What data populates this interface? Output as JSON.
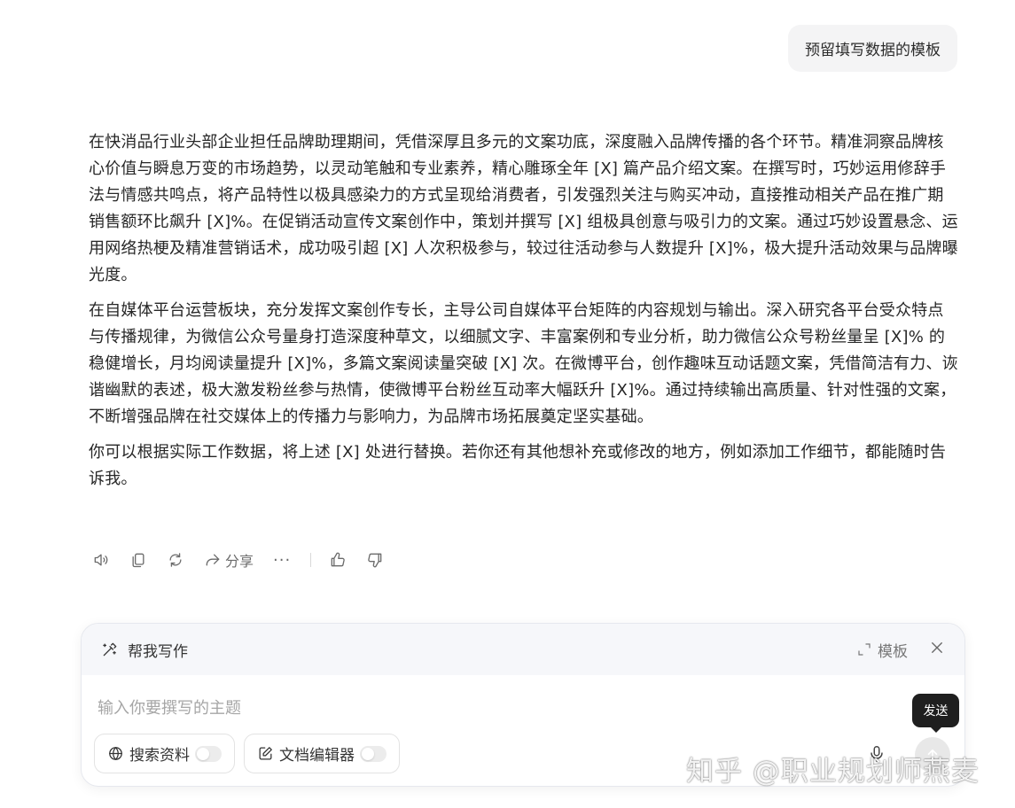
{
  "user_message": "预留填写数据的模板",
  "answer_paragraphs": [
    "在快消品行业头部企业担任品牌助理期间，凭借深厚且多元的文案功底，深度融入品牌传播的各个环节。精准洞察品牌核心价值与瞬息万变的市场趋势，以灵动笔触和专业素养，精心雕琢全年 [X] 篇产品介绍文案。在撰写时，巧妙运用修辞手法与情感共鸣点，将产品特性以极具感染力的方式呈现给消费者，引发强烈关注与购买冲动，直接推动相关产品在推广期销售额环比飙升 [X]%。在促销活动宣传文案创作中，策划并撰写 [X] 组极具创意与吸引力的文案。通过巧妙设置悬念、运用网络热梗及精准营销话术，成功吸引超 [X] 人次积极参与，较过往活动参与人数提升 [X]%，极大提升活动效果与品牌曝光度。",
    "在自媒体平台运营板块，充分发挥文案创作专长，主导公司自媒体平台矩阵的内容规划与输出。深入研究各平台受众特点与传播规律，为微信公众号量身打造深度种草文，以细腻文字、丰富案例和专业分析，助力微信公众号粉丝量呈 [X]% 的稳健增长，月均阅读量提升 [X]%，多篇文案阅读量突破 [X] 次。在微博平台，创作趣味互动话题文案，凭借简洁有力、诙谐幽默的表述，极大激发粉丝参与热情，使微博平台粉丝互动率大幅跃升 [X]%。通过持续输出高质量、针对性强的文案，不断增强品牌在社交媒体上的传播力与影响力，为品牌市场拓展奠定坚实基础。",
    "你可以根据实际工作数据，将上述 [X] 处进行替换。若你还有其他想补充或修改的地方，例如添加工作细节，都能随时告诉我。"
  ],
  "actions": {
    "share_label": "分享",
    "more_label": "···"
  },
  "composer": {
    "title": "帮我写作",
    "template_label": "模板",
    "input_placeholder": "输入你要撰写的主题",
    "chip_search": "搜索资料",
    "chip_editor": "文档编辑器",
    "send_tooltip": "发送"
  },
  "watermark": "知乎 @职业规划师燕麦"
}
